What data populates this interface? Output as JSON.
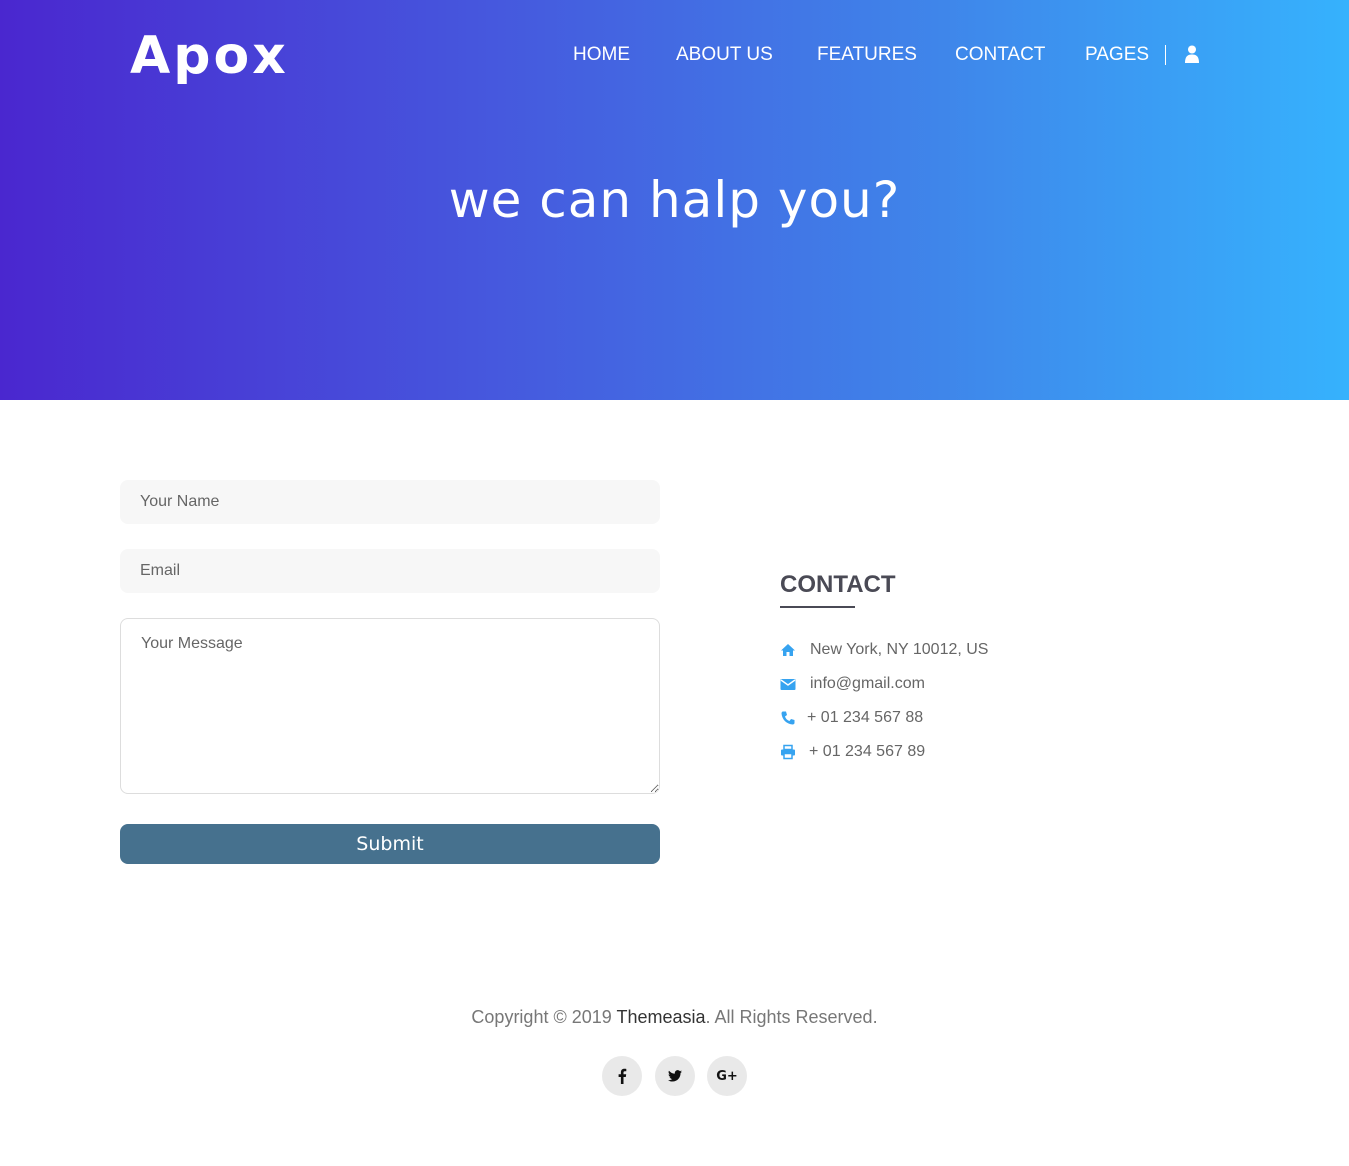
{
  "header": {
    "logo": "Apox",
    "nav": [
      {
        "label": "HOME"
      },
      {
        "label": "ABOUT US"
      },
      {
        "label": "FEATURES"
      },
      {
        "label": "CONTACT"
      },
      {
        "label": "PAGES"
      }
    ],
    "user_icon": "user-icon"
  },
  "hero": {
    "title": "we can halp you?"
  },
  "form": {
    "name_placeholder": "Your Name",
    "email_placeholder": "Email",
    "message_placeholder": "Your Message",
    "submit_label": "Submit"
  },
  "contact": {
    "heading": "CONTACT",
    "address": "New York, NY 10012, US",
    "email": "info@gmail.com",
    "phone": "+ 01 234 567 88",
    "fax": "+ 01 234 567 89"
  },
  "footer": {
    "copyright_prefix": "Copyright © 2019 ",
    "brand": "Themeasia",
    "copyright_suffix": ". All Rights Reserved.",
    "social": [
      {
        "icon": "facebook-icon",
        "glyph": "f"
      },
      {
        "icon": "twitter-icon",
        "glyph": "t"
      },
      {
        "icon": "google-plus-icon",
        "glyph": "G+"
      }
    ]
  },
  "colors": {
    "accent": "#36a3f0",
    "submit_bg": "#46718e",
    "gradient_start": "#4a27cf",
    "gradient_end": "#36b2fd"
  }
}
